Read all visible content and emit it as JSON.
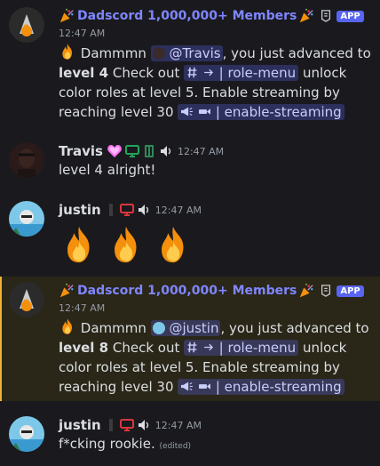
{
  "messages": [
    {
      "author": "Dadscord 1,000,000+ Members",
      "badge": "APP",
      "timestamp": "12:47 AM",
      "greeting": "Dammmn",
      "mention": "@Travis",
      "advanced_text": ", you just advanced to",
      "level_label": "level 4",
      "check_out": "Check out",
      "channel_role": "role-menu",
      "unlock_text": "unlock color roles at level 5. Enable streaming by reaching level 30",
      "channel_stream": "enable-streaming"
    },
    {
      "author": "Travis",
      "timestamp": "12:47 AM",
      "text": "level 4 alright!"
    },
    {
      "author": "justin",
      "timestamp": "12:47 AM"
    },
    {
      "author": "Dadscord 1,000,000+ Members",
      "badge": "APP",
      "timestamp": "12:47 AM",
      "greeting": "Dammmn",
      "mention": "@justin",
      "advanced_text": ", you just advanced to",
      "level_label": "level 8",
      "check_out": "Check out",
      "channel_role": "role-menu",
      "unlock_text": "unlock color roles at level 5. Enable streaming by reaching level 30",
      "channel_stream": "enable-streaming"
    },
    {
      "author": "justin",
      "timestamp": "12:47 AM",
      "text": "f*cking rookie.",
      "edited": "(edited)"
    }
  ],
  "colors": {
    "bot_name": "#7f86ff",
    "mention_bg": "#3c4270",
    "highlight_bg": "#2a2618",
    "app_badge": "#5865f2"
  }
}
